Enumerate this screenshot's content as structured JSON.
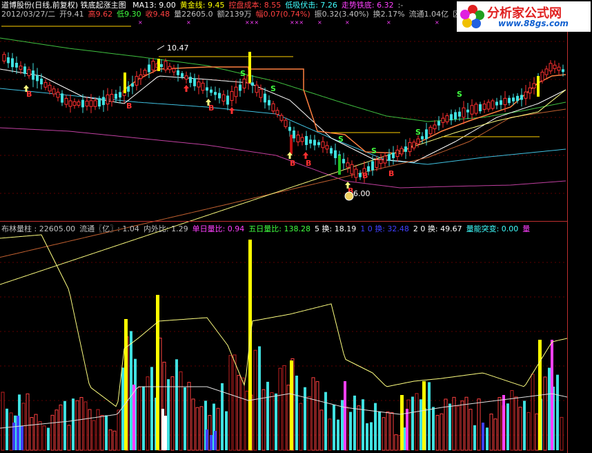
{
  "header": {
    "stock_title": "道博股份(日线,前复权) 铁底起涨主图",
    "indicators": [
      {
        "label": "MA13: 9.00",
        "color": "#ffffff"
      },
      {
        "label": "黄金线: 9.45",
        "color": "#ffff00"
      },
      {
        "label": "控盘成本: 8.55",
        "color": "#ff4040"
      },
      {
        "label": "低吸伏击: 7.26",
        "color": "#40ffff"
      },
      {
        "label": "走势铁底: 6.32",
        "color": "#ff40ff"
      },
      {
        "label": ":-",
        "color": "#c0c0c0"
      }
    ]
  },
  "ohlc": [
    {
      "label": "2012/03/27/二",
      "color": "#c0c0c0"
    },
    {
      "label": "开9.41",
      "color": "#c0c0c0"
    },
    {
      "label": "高9.62",
      "color": "#ff4040"
    },
    {
      "label": "低9.30",
      "color": "#40ff40"
    },
    {
      "label": "收9.48",
      "color": "#ff4040"
    },
    {
      "label": "量22605.0",
      "color": "#c0c0c0"
    },
    {
      "label": "额2139万",
      "color": "#c0c0c0"
    },
    {
      "label": "幅0.07(0.74%)",
      "color": "#ff4040"
    },
    {
      "label": "振0.32(3.40%)",
      "color": "#c0c0c0"
    },
    {
      "label": "换2.17%",
      "color": "#c0c0c0"
    },
    {
      "label": "流通1.04亿",
      "color": "#c0c0c0"
    },
    {
      "label": "区域",
      "color": "#c0c0c0"
    }
  ],
  "event_marks": [
    "×",
    "×",
    "×××",
    "×××",
    "×",
    "×",
    "×",
    "×"
  ],
  "annotations": {
    "high_price": "10.47",
    "low_price": "6.00"
  },
  "signal_labels": {
    "buy": "B",
    "sell": "S"
  },
  "volume_header": [
    {
      "label": "布林量柱 : 22605.00",
      "color": "#c0c0c0"
    },
    {
      "label": "流通〖亿〗: 1.04",
      "color": "#c0c0c0"
    },
    {
      "label": "内外比: 1.29",
      "color": "#c0c0c0"
    },
    {
      "label": "单日量比: 0.94",
      "color": "#ff40ff"
    },
    {
      "label": "五日量比: 138.28",
      "color": "#40ff40"
    },
    {
      "label": "5 换: 18.19",
      "color": "#ffffff"
    },
    {
      "label": "1 0 换: 32.48",
      "color": "#4040ff"
    },
    {
      "label": "2 0 换: 49.67",
      "color": "#ffffff"
    },
    {
      "label": "量能突变: 0.00",
      "color": "#40ffff"
    },
    {
      "label": "量",
      "color": "#ff40ff"
    }
  ],
  "logo": {
    "title": "分析家公式网",
    "url": "www.88gs.com"
  },
  "chart_data": [
    {
      "type": "line",
      "subtype": "candlestick",
      "title": "道博股份(日线,前复权) 铁底起涨主图",
      "series": [
        {
          "name": "MA13",
          "last": 9.0
        },
        {
          "name": "黄金线",
          "last": 9.45
        },
        {
          "name": "控盘成本",
          "last": 8.55
        },
        {
          "name": "低吸伏击",
          "last": 7.26
        },
        {
          "name": "走势铁底",
          "last": 6.32
        }
      ],
      "annotations": [
        {
          "text": "10.47"
        },
        {
          "text": "6.00"
        }
      ]
    },
    {
      "type": "bar",
      "title": "布林量柱",
      "last_volume": 22605.0
    }
  ],
  "colors": {
    "up": "#ff3030",
    "down": "#40e0e0",
    "grid": "#800000",
    "border": "#c03030"
  }
}
